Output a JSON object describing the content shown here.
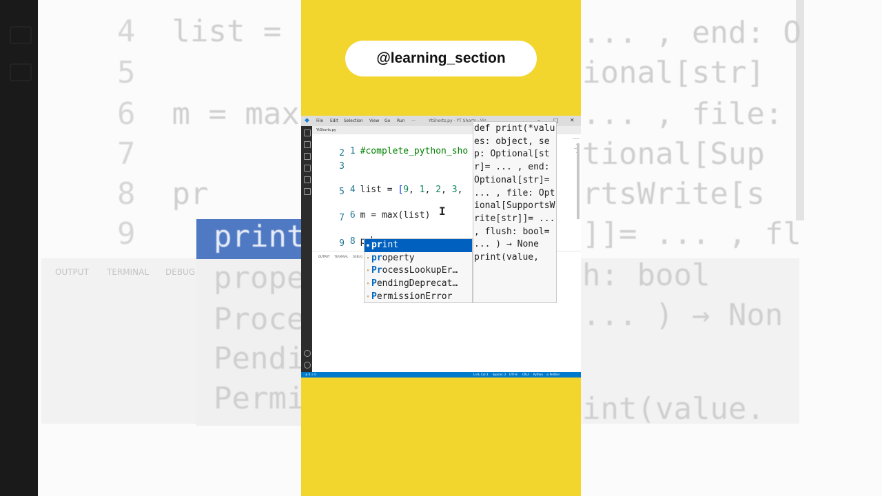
{
  "overlay": {
    "handle": "@learning_section"
  },
  "window": {
    "menu": [
      "File",
      "Edit",
      "Selection",
      "View",
      "Go",
      "Run",
      "···"
    ],
    "title": "YtShorts.py - YT Shorts - Vis...",
    "tab_name": "YtShorts.py"
  },
  "editor": {
    "line_numbers": [
      "1",
      "2",
      "3",
      "4",
      "5",
      "6",
      "7",
      "8",
      "9"
    ],
    "line1_comment": "#complete_python_sho",
    "line4_list": "list = ",
    "line4_vals": [
      "9",
      "1",
      "2",
      "3"
    ],
    "line6": "m = max(list)",
    "line8": "pr"
  },
  "suggestions": [
    {
      "prefix": "pr",
      "rest": "int",
      "selected": true
    },
    {
      "prefix": "pr",
      "rest": "operty",
      "selected": false
    },
    {
      "prefix": "Pr",
      "rest": "ocessLookupEr…",
      "selected": false
    },
    {
      "prefix": "P",
      "rest": "endingDeprecat…",
      "selected": false
    },
    {
      "prefix": "P",
      "rest": "ermissionError",
      "selected": false
    }
  ],
  "docs": {
    "signature": "def print(*values: object, sep: Optional[str]= ... , end: Optional[str]= ... , file: Optional[SupportsWrite[str]]= ... , flush: bool= ... ) → None",
    "example": "print(value,"
  },
  "panel": {
    "tabs": [
      "OUTPUT",
      "TERMINAL",
      "DEBUG"
    ]
  },
  "status_bar": {
    "left": "⊗ 0 ⚠ 0",
    "items": [
      "Ln 8, Col 3",
      "Spaces: 2",
      "UTF-8",
      "CRLF",
      "Python",
      "⊘ Prettier"
    ]
  },
  "background": {
    "lines": [
      {
        "n": "4",
        "text": "list = "
      },
      {
        "n": "5",
        "text": ""
      },
      {
        "n": "6",
        "text": "m = max("
      },
      {
        "n": "7",
        "text": ""
      },
      {
        "n": "8",
        "text": "pr"
      },
      {
        "n": "9",
        "text": ""
      }
    ],
    "sugg": [
      "print",
      "prope",
      "Proce",
      "Pendi",
      "Permi"
    ],
    "doc_lines": [
      "... , end: O",
      "ional[str]",
      "... , file:",
      "tional[Sup",
      "rtsWrite[s",
      "]]= ... , fl",
      "h: bool",
      "... ) → Non",
      "int(value."
    ],
    "panel_tabs": [
      "OUTPUT",
      "TERMINAL",
      "DEBUG"
    ]
  },
  "colors": {
    "yellow": "#f2d62e",
    "accent": "#007acc",
    "selection": "#0060c0"
  }
}
